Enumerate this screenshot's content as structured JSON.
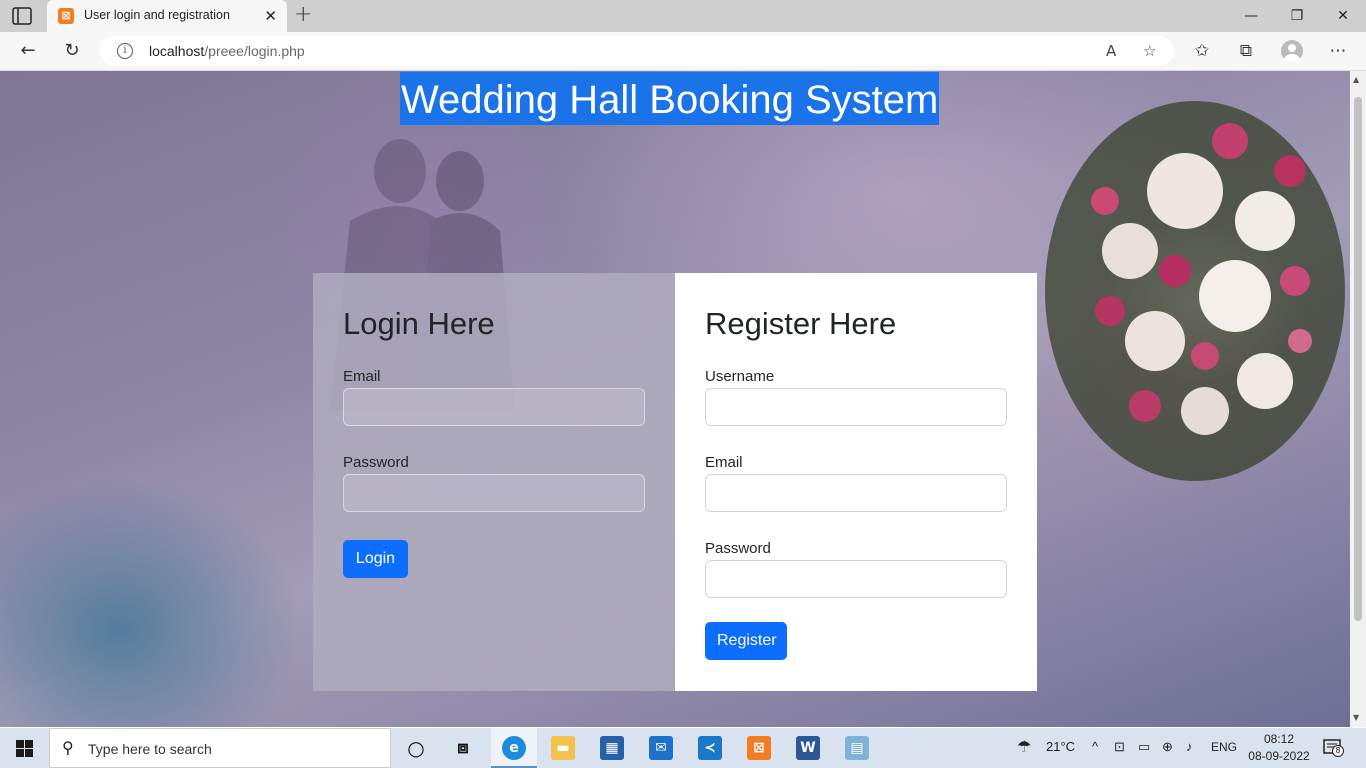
{
  "browser": {
    "tab_title": "User login and registration",
    "tab_close": "✕",
    "new_tab": "+",
    "url_host": "localhost",
    "url_path": "/preee/login.php",
    "window_controls": [
      "—",
      "❐",
      "✕"
    ],
    "icons": [
      "sidebar-icon",
      "back-arrow-icon",
      "refresh-icon",
      "info-icon",
      "read-aloud-icon",
      "add-favorite-icon",
      "favorites-icon",
      "collections-icon",
      "profile-icon",
      "more-icon"
    ]
  },
  "page": {
    "title": "Wedding Hall Booking System",
    "login": {
      "heading": "Login Here",
      "email_label": "Email",
      "password_label": "Password",
      "button": "Login"
    },
    "register": {
      "heading": "Register Here",
      "username_label": "Username",
      "email_label": "Email",
      "password_label": "Password",
      "button": "Register"
    }
  },
  "taskbar": {
    "search_placeholder": "Type here to search",
    "weather": "21°C",
    "language": "ENG",
    "time": "08:12",
    "date": "08-09-2022",
    "notifications": "8",
    "apps": [
      "cortana-icon",
      "task-view-icon",
      "edge-icon",
      "file-explorer-icon",
      "store-icon",
      "mail-icon",
      "vscode-icon",
      "xampp-icon",
      "word-icon",
      "notepad-icon"
    ]
  },
  "colors": {
    "title_highlight": "#1a73e8",
    "button_primary": "#0d6efd",
    "taskbar_bg": "#d9e3ef"
  }
}
